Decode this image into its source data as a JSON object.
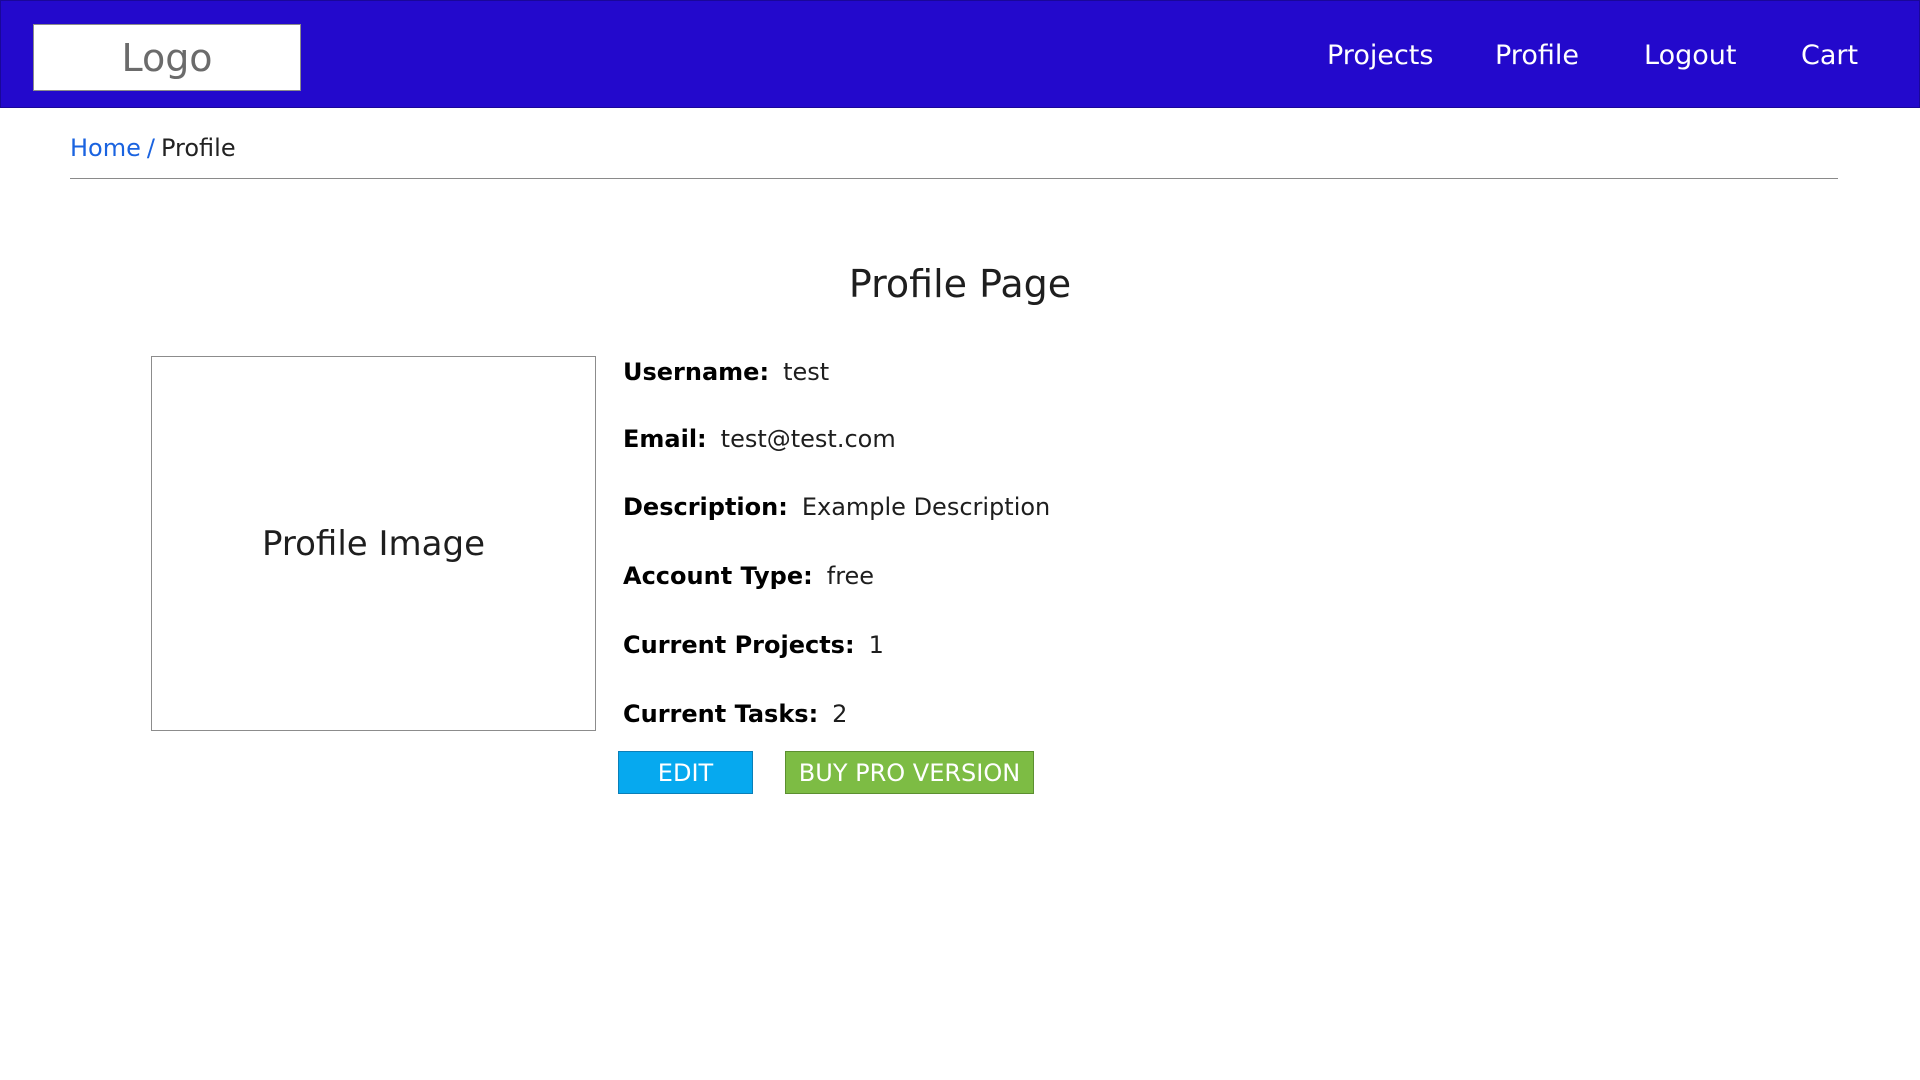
{
  "header": {
    "logo": "Logo",
    "nav": [
      {
        "label": "Projects"
      },
      {
        "label": "Profile"
      },
      {
        "label": "Logout"
      },
      {
        "label": "Cart"
      }
    ]
  },
  "breadcrumb": {
    "home": "Home",
    "separator": "/",
    "current": "Profile"
  },
  "main": {
    "title": "Profile Page",
    "image_placeholder": "Profile Image",
    "fields": [
      {
        "label": "Username:",
        "value": "test"
      },
      {
        "label": "Email:",
        "value": "test@test.com"
      },
      {
        "label": "Description:",
        "value": "Example Description"
      },
      {
        "label": "Account Type:",
        "value": "free"
      },
      {
        "label": "Current Projects:",
        "value": "1"
      },
      {
        "label": "Current Tasks:",
        "value": "2"
      }
    ],
    "buttons": {
      "edit": "EDIT",
      "buy_pro": "BUY PRO VERSION"
    }
  },
  "colors": {
    "header_bg": "#2309cc",
    "link": "#1a63e0",
    "edit_button": "#06a9ef",
    "pro_button": "#7dbc44"
  }
}
